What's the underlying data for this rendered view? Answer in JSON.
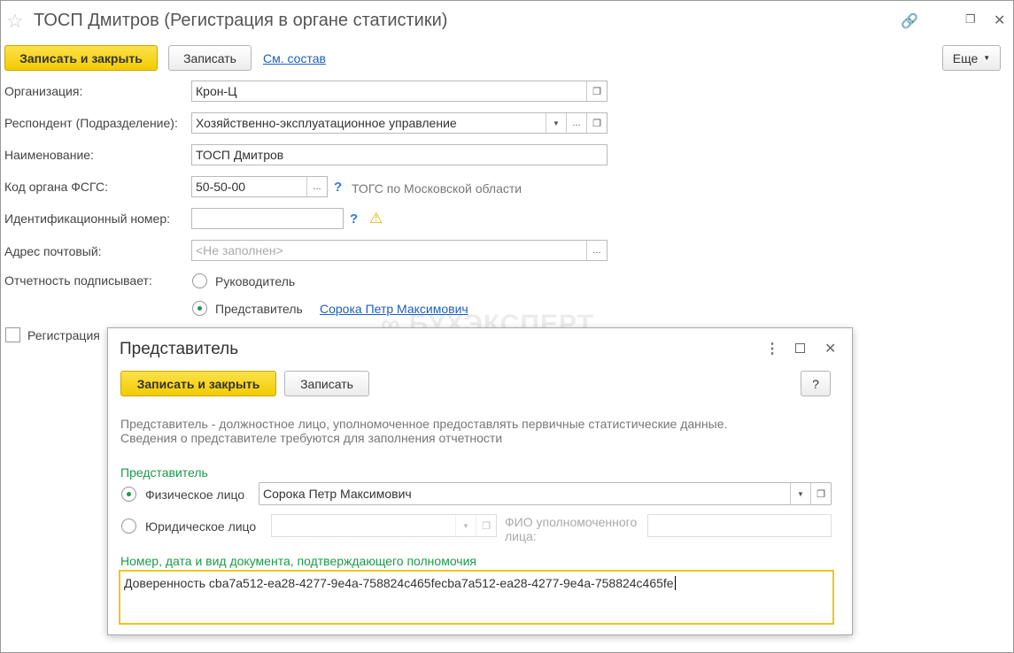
{
  "window": {
    "title": "ТОСП Дмитров (Регистрация в органе статистики)"
  },
  "toolbar": {
    "save_close": "Записать и закрыть",
    "save": "Записать",
    "view_link": "См. состав",
    "more": "Еще"
  },
  "form": {
    "org_label": "Организация:",
    "org_value": "Крон-Ц",
    "resp_label": "Респондент (Подразделение):",
    "resp_value": "Хозяйственно-эксплуатационное управление",
    "name_label": "Наименование:",
    "name_value": "ТОСП Дмитров",
    "code_label": "Код органа ФСГС:",
    "code_value": "50-50-00",
    "code_hint": "ТОГС по Московской области",
    "id_label": "Идентификационный номер:",
    "id_value": "",
    "addr_label": "Адрес почтовый:",
    "addr_placeholder": "<Не заполнен>",
    "signer_label": "Отчетность подписывает:",
    "signer_opt1": "Руководитель",
    "signer_opt2": "Представитель",
    "signer_rep": "Сорока Петр Максимович",
    "reg_checkbox": "Регистрация",
    "help_mark": "?"
  },
  "watermark": "БУХЭКСПЕРТ",
  "dialog": {
    "title": "Представитель",
    "save_close": "Записать и закрыть",
    "save": "Записать",
    "help": "?",
    "desc1": "Представитель - должностное лицо, уполномоченное предоставлять первичные статистические данные.",
    "desc2": "Сведения о представителе требуются для заполнения отчетности",
    "section": "Представитель",
    "person_label": "Физическое лицо",
    "person_value": "Сорока Петр Максимович",
    "legal_label": "Юридическое лицо",
    "legal_value": "",
    "fio_label1": "ФИО уполномоченного",
    "fio_label2": "лица:",
    "fio_value": "",
    "doc_label": "Номер, дата и вид документа, подтверждающего полномочия",
    "doc_value": "Доверенность cba7a512-ea28-4277-9e4a-758824c465fecba7a512-ea28-4277-9e4a-758824c465fe"
  }
}
